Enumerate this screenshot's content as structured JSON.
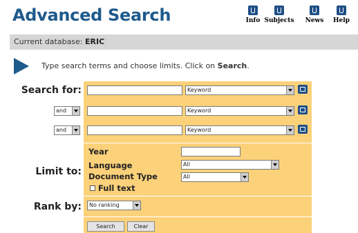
{
  "header": {
    "title": "Advanced Search"
  },
  "nav": {
    "items": [
      {
        "label": "Info",
        "icon": "info-icon"
      },
      {
        "label": "Subjects",
        "icon": "subjects-icon"
      },
      {
        "label": "News",
        "icon": "news-icon"
      },
      {
        "label": "Help",
        "icon": "help-icon"
      }
    ]
  },
  "database": {
    "label": "Current database:",
    "name": "ERIC"
  },
  "instruction": {
    "text": "Type search terms and choose limits. Click on ",
    "bold": "Search",
    "end": "."
  },
  "search": {
    "label": "Search for:",
    "rows": [
      {
        "term": "",
        "field": "Keyword"
      },
      {
        "operator": "and",
        "term": "",
        "field": "Keyword"
      },
      {
        "operator": "and",
        "term": "",
        "field": "Keyword"
      }
    ]
  },
  "limit": {
    "label": "Limit to:",
    "year_label": "Year",
    "year_value": "",
    "language_label": "Language",
    "language_value": "All",
    "doctype_label": "Document Type",
    "doctype_value": "All",
    "fulltext_label": "Full text",
    "fulltext_checked": false
  },
  "rank": {
    "label": "Rank by:",
    "value": "No ranking"
  },
  "buttons": {
    "search": "Search",
    "clear": "Clear"
  },
  "colors": {
    "title": "#1f5a8c",
    "panel": "#fbd17a",
    "db_bar": "#d6d6d6",
    "icon": "#1f4f86"
  }
}
